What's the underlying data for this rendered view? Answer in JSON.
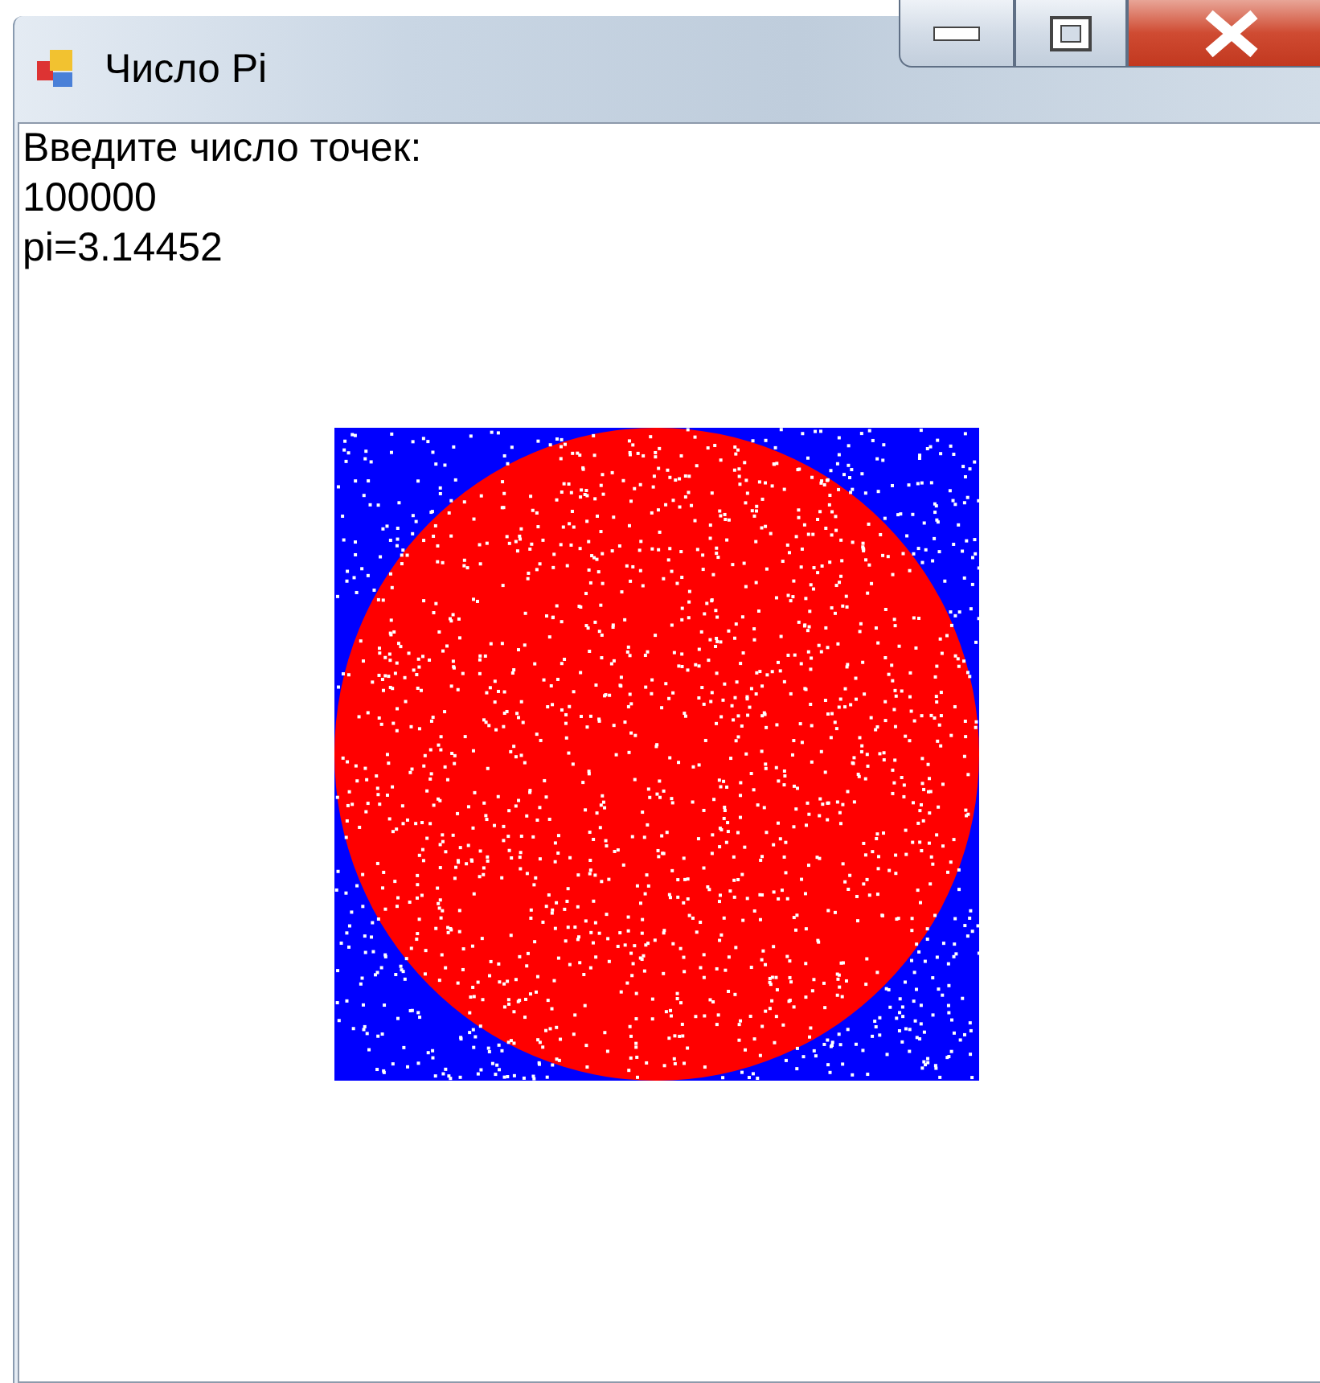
{
  "window": {
    "title": "Число Pi"
  },
  "lines": [
    "Введите число точек:",
    "100000",
    "pi=3.14452"
  ]
}
